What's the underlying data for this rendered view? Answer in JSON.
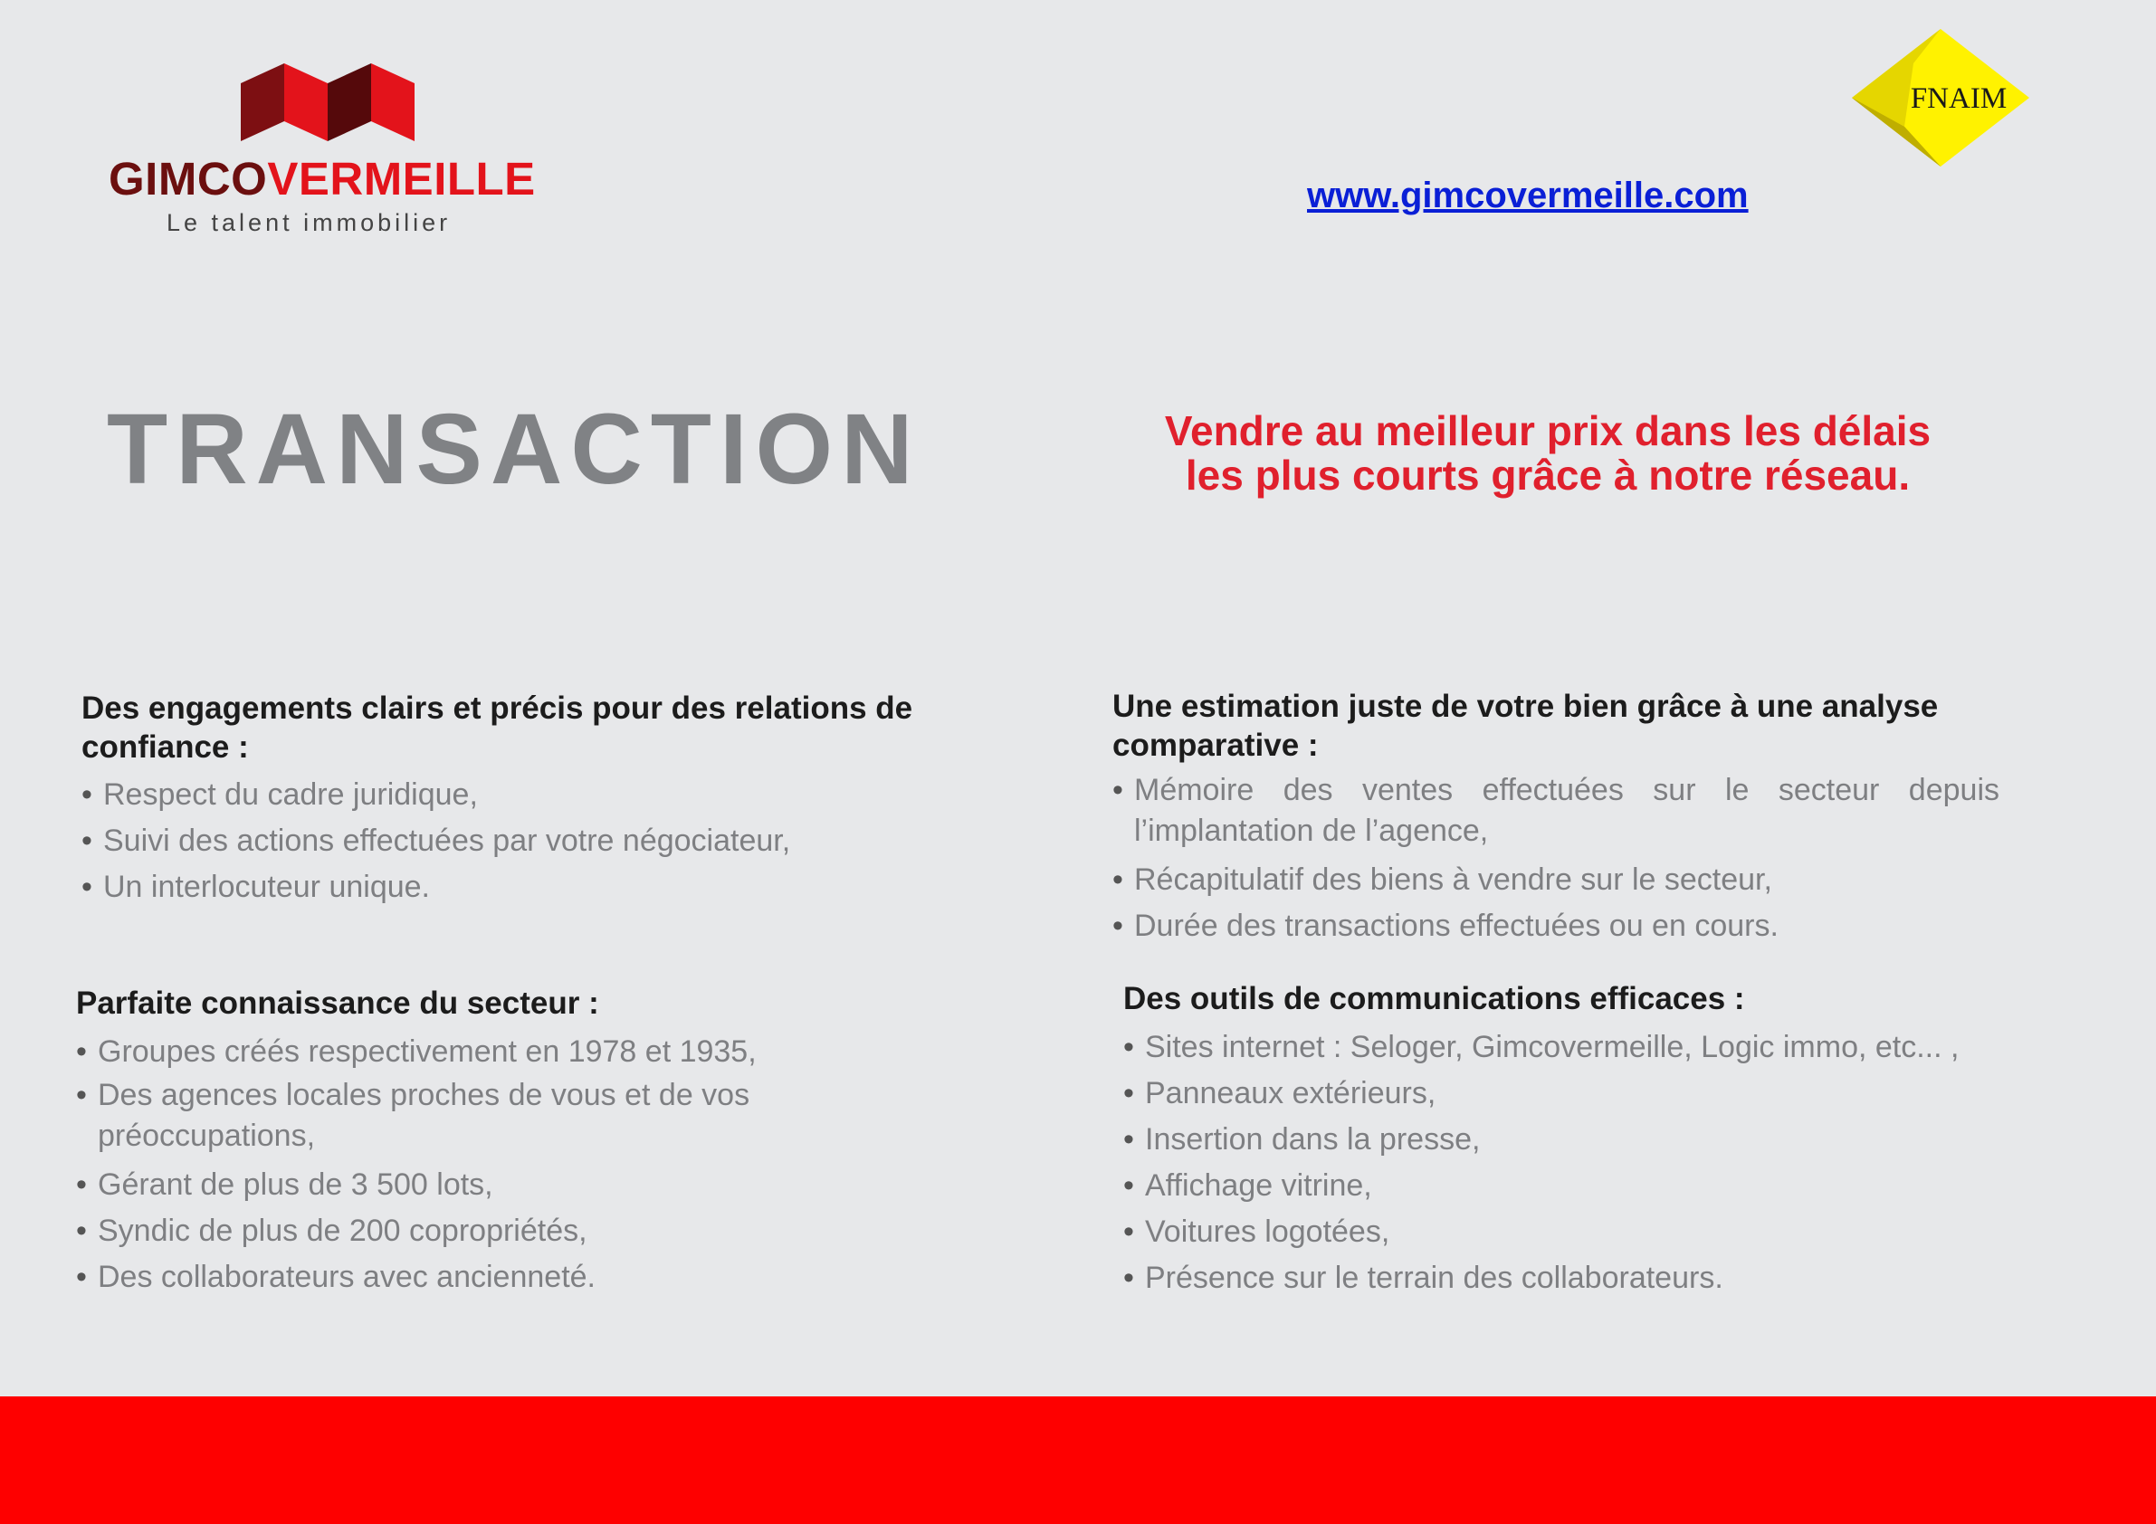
{
  "brand": {
    "name_dark": "GIMCO",
    "name_red": "VERMEILLE",
    "tagline": "Le talent immobilier"
  },
  "fnaim": {
    "label": "FNAIM"
  },
  "url": "www.gimcovermeille.com",
  "title": "TRANSACTION",
  "tagline": {
    "line1": "Vendre au meilleur prix dans les délais",
    "line2": "les plus courts grâce à notre réseau."
  },
  "engagements": {
    "heading": "Des engagements clairs et précis pour des relations de confiance :",
    "items": [
      "Respect du cadre juridique,",
      "Suivi des actions effectuées par votre négociateur,",
      "Un interlocuteur unique."
    ]
  },
  "estimation": {
    "heading": "Une estimation juste de votre bien grâce à une analyse comparative :",
    "items": [
      "Mémoire des ventes effectuées sur le secteur depuis l’implantation de l’agence,",
      "Récapitulatif des biens à vendre sur le secteur,",
      "Durée des transactions effectuées ou en cours."
    ]
  },
  "connaissance": {
    "heading": "Parfaite connaissance du secteur :",
    "items": [
      "Groupes créés respectivement en 1978 et 1935,",
      "Des agences locales proches de vous et de vos préoccupations,",
      "Gérant de plus de 3 500 lots,",
      "Syndic de plus de 200 copropriétés,",
      "Des collaborateurs avec ancienneté."
    ]
  },
  "outils": {
    "heading": "Des outils de communications efficaces :",
    "items": [
      "Sites internet : Seloger, Gimcovermeille, Logic immo, etc... ,",
      "Panneaux extérieurs,",
      "Insertion dans la presse,",
      "Affichage vitrine,",
      "Voitures logotées,",
      "Présence sur le terrain des collaborateurs."
    ]
  },
  "colors": {
    "background": "#e7e8ea",
    "brand_red": "#e3131b",
    "brand_dark": "#6b0f0f",
    "tagline_red": "#e0202d",
    "title_grey": "#808285",
    "body_grey": "#7e7f82",
    "link_blue": "#0a1fd6",
    "footer_red": "#fe0000",
    "fnaim_yellow": "#fff200"
  }
}
